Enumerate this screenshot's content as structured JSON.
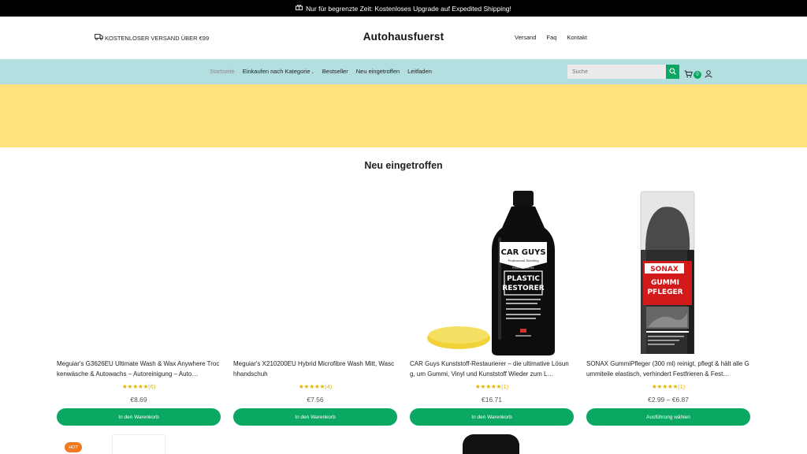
{
  "announcement": {
    "text": "Nur für begrenzte Zeit: Kostenloses Upgrade auf Expedited Shipping!",
    "icon": "gift-icon"
  },
  "header": {
    "shipping_text": "KOSTENLOSER VERSAND ÜBER €99",
    "logo": "Autohausfuerst",
    "links": [
      "Versand",
      "Faq",
      "Kontakt"
    ]
  },
  "nav": {
    "items": [
      "Startseite",
      "Einkaufen nach Kategorie",
      "Bestseller",
      "Neu eingetroffen",
      "Leitfaden"
    ],
    "search_placeholder": "Suche",
    "cart_count": "0"
  },
  "colors": {
    "accent": "#0aa862",
    "navbar": "#b3dfe0",
    "banner": "#ffe27c",
    "star": "#e4b500",
    "hot_badge": "#f07a21"
  },
  "section": {
    "title": "Neu eingetroffen"
  },
  "products": [
    {
      "name": "Meguiar's G3626EU Ultimate Wash & Wax Anywhere Trockenwäsche & Autowachs – Autoreinigung – Auto…",
      "stars": "★★★★★",
      "reviews": "(6)",
      "rating": 5,
      "price": "€8.69",
      "button": "In den Warenkorb"
    },
    {
      "name": "Meguiar's X210200EU Hybrid Microfibre Wash Mitt, Waschhandschuh",
      "stars": "★★★★★",
      "reviews": "(4)",
      "rating": 5,
      "price": "€7.56",
      "button": "In den Warenkorb"
    },
    {
      "name": "CAR Guys Kunststoff-Restaurierer – die ultimative Lösung, um Gummi, Vinyl und Kunststoff Wieder zum L…",
      "stars": "★★★★★",
      "reviews": "(1)",
      "rating": 5,
      "price": "€16.71",
      "button": "In den Warenkorb",
      "image_text": {
        "brand": "CAR GUYS",
        "sub": "Professional Detailing",
        "line": "Premium Series",
        "product1": "PLASTIC",
        "product2": "RESTORER"
      }
    },
    {
      "name": "SONAX GummiPfleger (300 ml) reinigt, pflegt & hält alle Gummiteile elastisch, verhindert Festfrieren & Fest…",
      "stars": "★★★★★",
      "reviews": "(1)",
      "rating": 5,
      "price": "€2.99 – €6.87",
      "button": "Ausführung wählen",
      "image_text": {
        "brand": "SONAX",
        "product1": "GUMMI",
        "product2": "PFLEGER"
      }
    }
  ],
  "badges": {
    "hot": "HOT"
  }
}
